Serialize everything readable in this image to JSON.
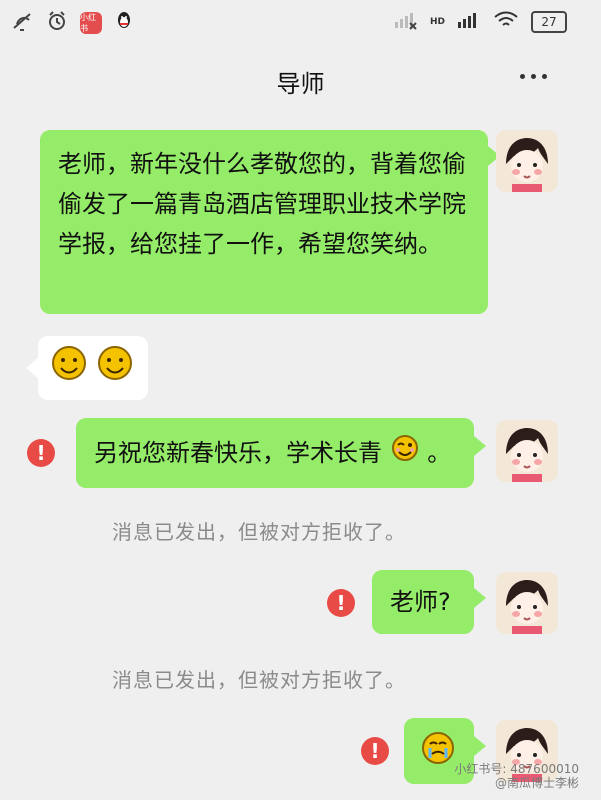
{
  "status": {
    "left_app_label": "小红书",
    "battery": "27",
    "network": "HD"
  },
  "header": {
    "title": "导师"
  },
  "messages": [
    {
      "text": "老师，新年没什么孝敬您的，背着您偷偷发了一篇青岛酒店管理职业技术学院学报，给您挂了一作，希望您笑纳。"
    },
    {
      "text": "另祝您新春快乐，学术长青"
    },
    {
      "text": "老师?"
    }
  ],
  "system": {
    "rejected_1": "消息已发出，但被对方拒收了。",
    "rejected_2": "消息已发出，但被对方拒收了。"
  },
  "watermark": {
    "line1": "小红书号: 487600010",
    "line2": "@南瓜博士李彬"
  }
}
